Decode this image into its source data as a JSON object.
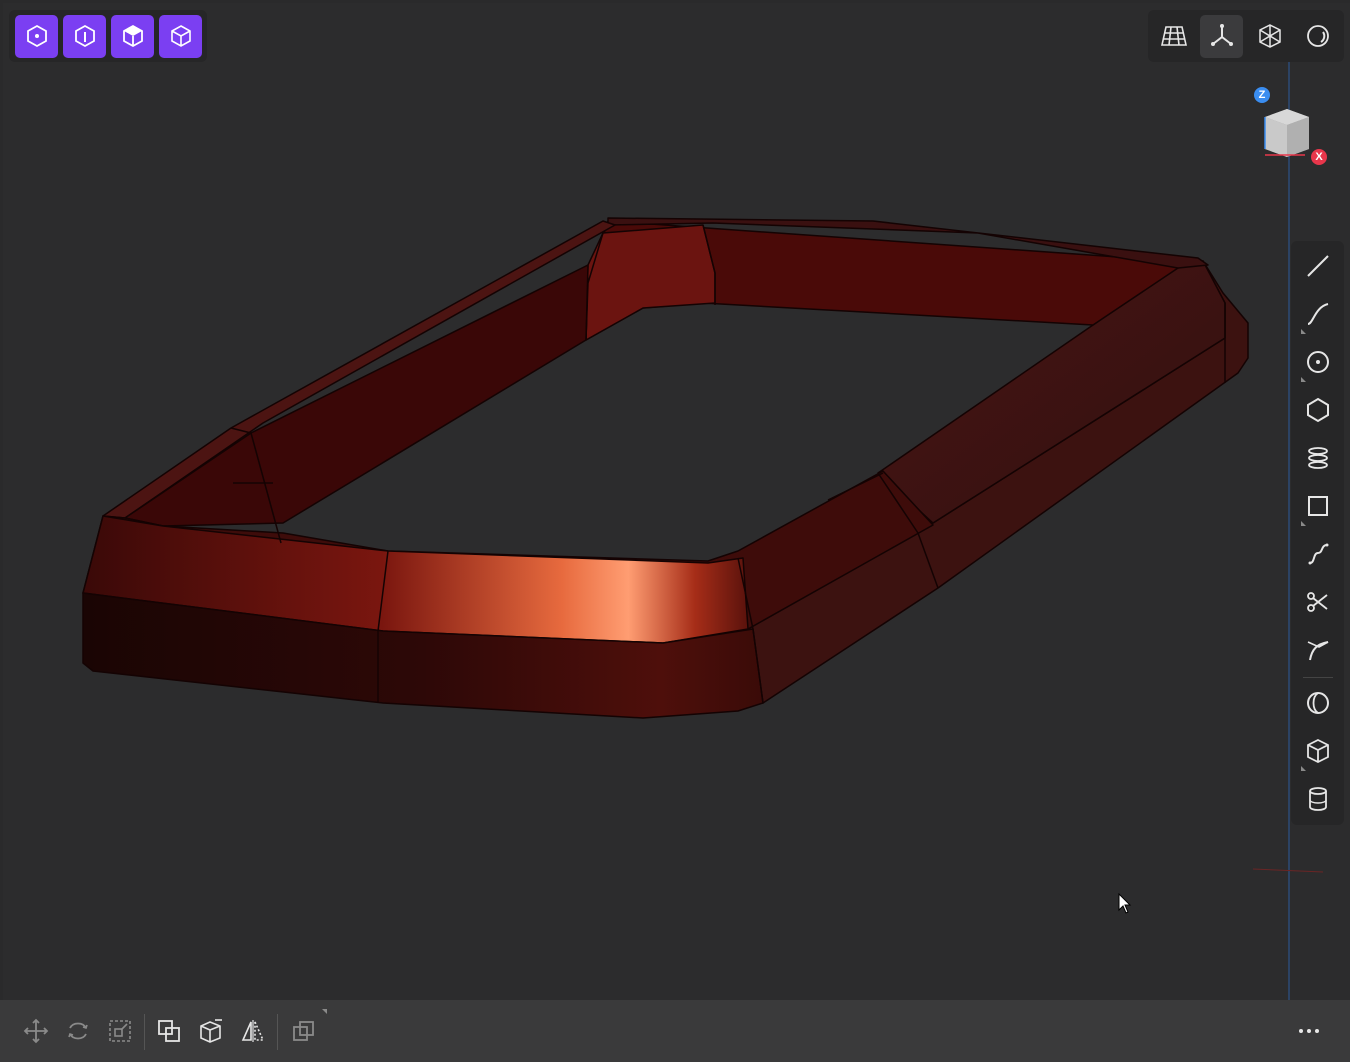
{
  "app": {
    "view_cube": {
      "axis_z": "Z",
      "axis_x": "X"
    }
  },
  "colors": {
    "accent": "#7b3ff2",
    "model": "#6b1410",
    "highlight": "#ff9a6a",
    "axis_z": "#3a8df0",
    "axis_x": "#e8364b"
  },
  "top_left_toolbar": {
    "buttons": [
      "top-view-icon",
      "front-view-icon",
      "iso-view-icon",
      "wire-view-icon"
    ]
  },
  "top_right_toolbar": {
    "buttons": [
      "grid-icon",
      "axes-icon",
      "wireframe-icon",
      "lighting-icon"
    ],
    "active": "axes-icon"
  },
  "right_toolbar": {
    "tools": [
      "line-icon",
      "curve-icon",
      "circle-icon",
      "polygon-icon",
      "stack-icon",
      "rectangle-icon",
      "spline-icon",
      "scissors-icon",
      "trim-icon",
      "revolve-icon",
      "box-icon",
      "cylinder-icon"
    ]
  },
  "bottom_toolbar": {
    "tools": [
      "move-icon",
      "rotate-icon",
      "scale-icon",
      "copy-icon",
      "extrude-face-icon",
      "mirror-icon",
      "duplicate-icon"
    ]
  }
}
